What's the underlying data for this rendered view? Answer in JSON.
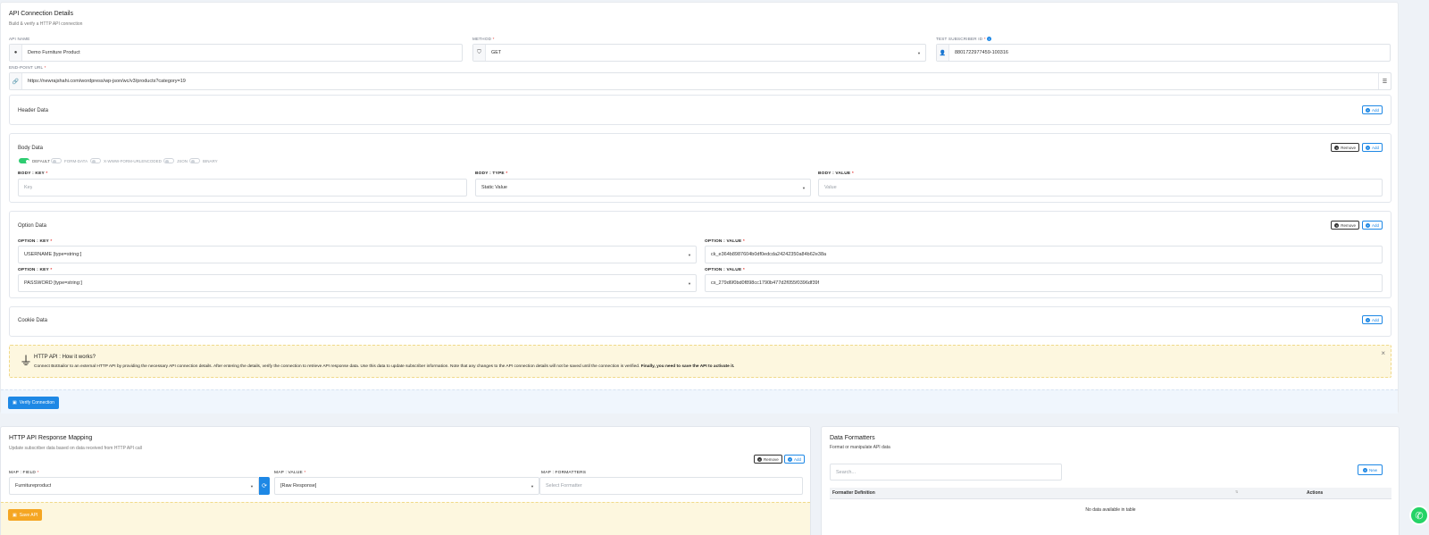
{
  "conn": {
    "title": "API Connection Details",
    "subtitle": "Build & verify a HTTP API connection",
    "api_name_label": "API NAME",
    "api_name_value": "Demo Furniture Product",
    "method_label": "METHOD",
    "method_value": "GET",
    "subscriber_label": "TEST SUBSCRIBER ID",
    "subscriber_value": "8801722977459-100316",
    "endpoint_label": "END-POINT URL",
    "endpoint_value": "https://newrajshahi.com/wordpress/wp-json/wc/v3/products?category=19"
  },
  "header": {
    "title": "Header Data",
    "add": "Add"
  },
  "body": {
    "title": "Body Data",
    "remove": "Remove",
    "add": "Add",
    "toggles": [
      "DEFAULT",
      "FORM-DATA",
      "X-WWW-FORM-URLENCODED",
      "JSON",
      "BINARY"
    ],
    "key_label": "BODY : KEY",
    "type_label": "BODY : TYPE",
    "value_label": "BODY : VALUE",
    "key_placeholder": "Key",
    "type_value": "Static Value",
    "value_placeholder": "Value"
  },
  "option": {
    "title": "Option Data",
    "remove": "Remove",
    "add": "Add",
    "key_label": "OPTION : KEY",
    "value_label": "OPTION : VALUE",
    "rows": [
      {
        "key": "USERNAME [type=string:]",
        "value": "ck_e364b8987604b0df0edcda24242350a84b62e38a"
      },
      {
        "key": "PASSWORD [type=string:]",
        "value": "cs_279d6f0bd0f898cc1790b477d2f055f0396df39f"
      }
    ]
  },
  "cookie": {
    "title": "Cookie Data",
    "add": "Add"
  },
  "info": {
    "title": "HTTP API : How it works?",
    "text": "Connect BotSailor to an external HTTP API by providing the necessary API connection details. After entering the details, verify the connection to retrieve API response data. Use this data to update subscriber information. Note that any changes to the API connection details will not be saved until the connection is verified.",
    "bold": "Finally, you need to save the API to activate it."
  },
  "verify_label": "Verify Connection",
  "mapping": {
    "title": "HTTP API Response Mapping",
    "subtitle": "Update subscriber data based on data received from HTTP API call",
    "remove": "Remove",
    "add": "Add",
    "field_label": "MAP : FIELD",
    "value_label": "MAP : VALUE",
    "formatters_label": "MAP : FORMATTERS",
    "field_value": "Furnitureproduct",
    "value_value": "[Raw Response]",
    "formatter_placeholder": "Select Formatter",
    "save": "Save API"
  },
  "formatters": {
    "title": "Data Formatters",
    "subtitle": "Format or manipulate API data",
    "search_placeholder": "Search...",
    "new": "New",
    "col_definition": "Formatter Definition",
    "col_actions": "Actions",
    "empty": "No data available in table"
  },
  "colors": {
    "primary": "#1e88e5",
    "success": "#2ecc71",
    "warning": "#f5a623",
    "info_bg": "#fdf7df",
    "whatsapp": "#25d366"
  }
}
